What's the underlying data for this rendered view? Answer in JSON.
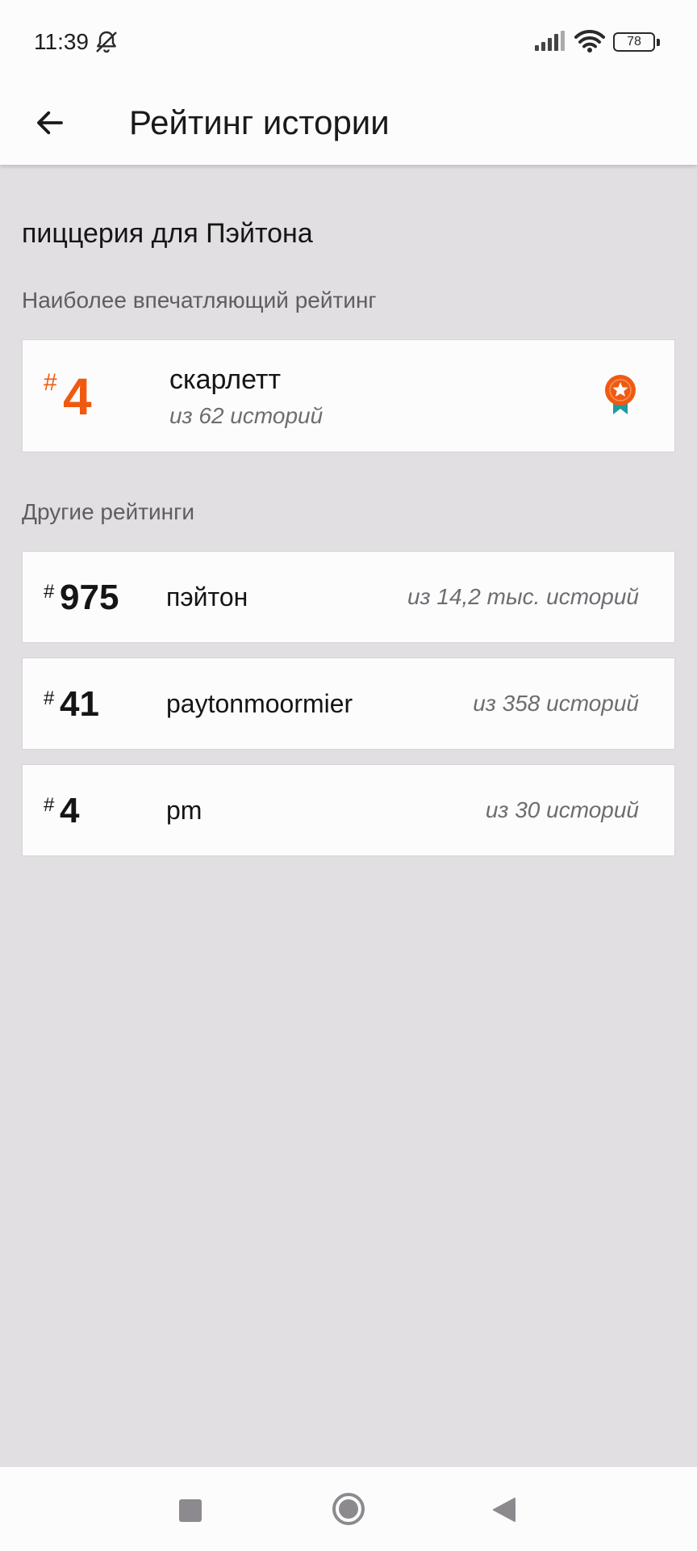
{
  "status_bar": {
    "time": "11:39",
    "battery": "78",
    "icons": [
      "bell-off-icon",
      "signal-icon",
      "wifi-icon",
      "battery-icon"
    ]
  },
  "header": {
    "title": "Рейтинг истории",
    "back_icon": "arrow-left-icon"
  },
  "story": {
    "title": "пиццерия для Пэйтона"
  },
  "featured": {
    "section_label": "Наиболее впечатляющий рейтинг",
    "hash": "#",
    "rank": "4",
    "tag": "скарлетт",
    "subtitle": "из 62 историй",
    "icon": "award-ribbon-icon",
    "accent_color": "#f05a10"
  },
  "others": {
    "section_label": "Другие рейтинги",
    "items": [
      {
        "hash": "#",
        "rank": "975",
        "tag": "пэйтон",
        "subtitle": "из 14,2 тыс. историй"
      },
      {
        "hash": "#",
        "rank": "41",
        "tag": "paytonmoormier",
        "subtitle": "из 358 историй"
      },
      {
        "hash": "#",
        "rank": "4",
        "tag": "pm",
        "subtitle": "из 30 историй"
      }
    ]
  },
  "nav_bar": {
    "buttons": [
      "recents-square-icon",
      "home-circle-icon",
      "back-triangle-icon"
    ]
  }
}
